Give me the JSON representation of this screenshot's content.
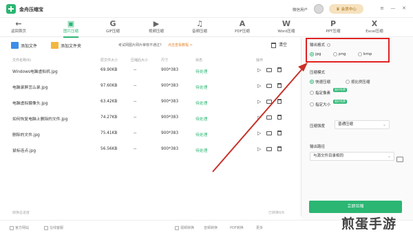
{
  "app": {
    "title": "金舟压缩宝",
    "user_name": "微信用户",
    "vip_label": "会员中心",
    "vip_icon": "crown-icon",
    "win_controls": [
      "≡",
      "—",
      "✕"
    ]
  },
  "toolbar": {
    "items": [
      {
        "label": "返回首页",
        "icon": "←"
      },
      {
        "label": "图片压缩",
        "icon": "▣",
        "active": true
      },
      {
        "label": "GIF压缩",
        "icon": "G"
      },
      {
        "label": "视频压缩",
        "icon": "▶"
      },
      {
        "label": "音频压缩",
        "icon": "♫"
      },
      {
        "label": "PDF压缩",
        "icon": "A"
      },
      {
        "label": "Word压缩",
        "icon": "W"
      },
      {
        "label": "PPT压缩",
        "icon": "P"
      },
      {
        "label": "Excel压缩",
        "icon": "X"
      }
    ]
  },
  "actions": {
    "add_file": "添加文件",
    "add_folder": "添加文件夹",
    "tip": "考试网图片网片审核不通过?",
    "tip_link": "点击查看教程 >",
    "clear": "清空"
  },
  "table": {
    "headers": [
      "文件名称(6)",
      "原文件大小",
      "压缩后大小",
      "尺寸",
      "状态",
      "操作"
    ],
    "rows": [
      {
        "name": "Windows电脑虚拟机.jpg",
        "size": "69.90KB",
        "after": "--",
        "dim": "900*383",
        "status": "待处理"
      },
      {
        "name": "电脑录屏怎么录.jpg",
        "size": "97.60KB",
        "after": "--",
        "dim": "900*383",
        "status": "待处理"
      },
      {
        "name": "电脑虚拟摄像头.jpg",
        "size": "63.42KB",
        "after": "--",
        "dim": "900*383",
        "status": "待处理"
      },
      {
        "name": "如何恢复电脑上删除的文件.jpg",
        "size": "74.27KB",
        "after": "--",
        "dim": "900*383",
        "status": "待处理"
      },
      {
        "name": "删除的文件.jpg",
        "size": "75.41KB",
        "after": "--",
        "dim": "900*383",
        "status": "待处理"
      },
      {
        "name": "鼠标连点.jpg",
        "size": "56.56KB",
        "after": "--",
        "dim": "900*383",
        "status": "待处理"
      }
    ]
  },
  "panel": {
    "output_format_label": "输出格式",
    "formats": [
      {
        "label": "jpg",
        "selected": true
      },
      {
        "label": "png",
        "selected": false
      },
      {
        "label": "bmp",
        "selected": false
      }
    ],
    "compress_mode_label": "压缩模式",
    "modes": [
      {
        "label": "快速压缩",
        "selected": true
      },
      {
        "label": "按比例压缩",
        "selected": false
      },
      {
        "label": "指定像素",
        "selected": false,
        "tag": "限时免费"
      },
      {
        "label": "指定大小",
        "selected": false,
        "tag": "限时免费"
      }
    ],
    "strength_label": "压缩强度",
    "strength_value": "普通压缩",
    "output_path_label": "输出路径",
    "output_path_value": "与源文件目录相同",
    "start_label": "立即压缩"
  },
  "progress": {
    "left": "转换总进度",
    "right": "已转换0/6"
  },
  "bottombar": {
    "items": [
      "官方网站",
      "在线客服",
      "视频转换",
      "音频转换",
      "PDF转换",
      "更多"
    ]
  },
  "watermark": "煎蛋手游",
  "colors": {
    "accent": "#2bb673",
    "highlight_box": "#e02020",
    "arrow": "#c8312a"
  }
}
